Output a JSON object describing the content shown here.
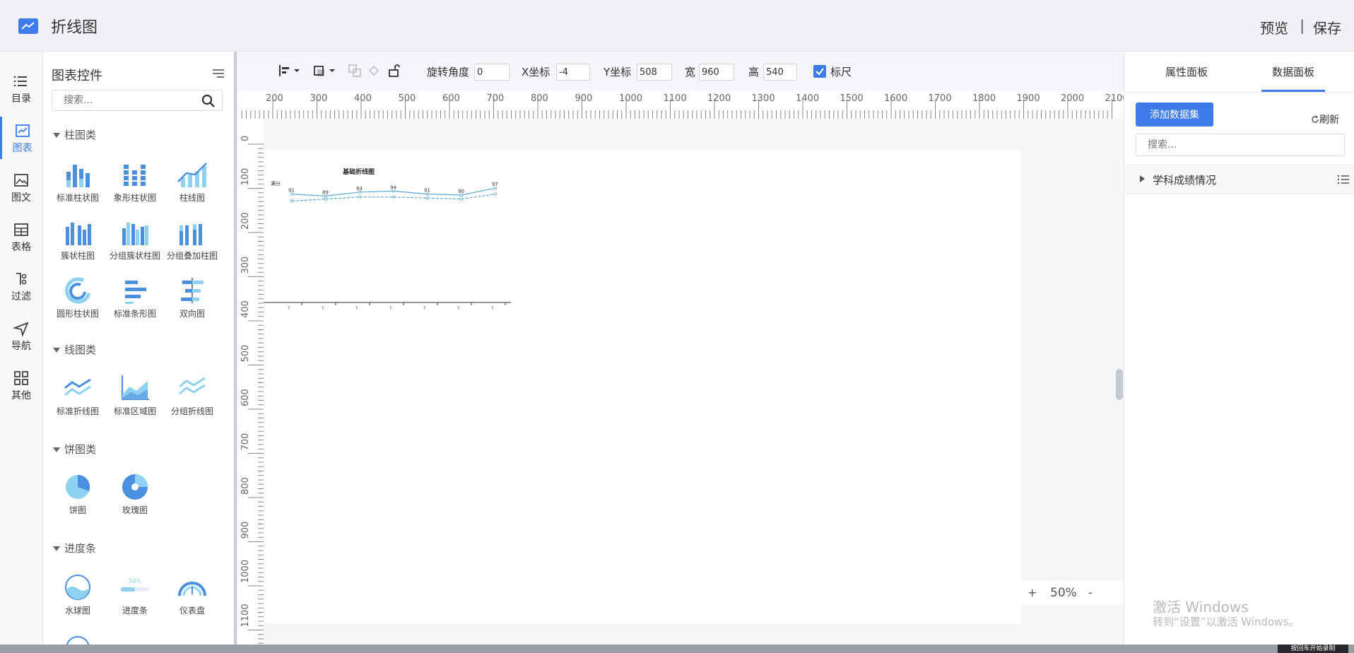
{
  "header": {
    "title": "折线图",
    "preview": "预览",
    "separator": "|",
    "save": "保存"
  },
  "nav": [
    {
      "label": "目录",
      "icon": "list-icon"
    },
    {
      "label": "图表",
      "icon": "chart-icon",
      "active": true
    },
    {
      "label": "图文",
      "icon": "image-icon"
    },
    {
      "label": "表格",
      "icon": "table-icon"
    },
    {
      "label": "过滤",
      "icon": "filter-icon"
    },
    {
      "label": "导航",
      "icon": "send-icon"
    },
    {
      "label": "其他",
      "icon": "grid-icon"
    }
  ],
  "widgets": {
    "title": "图表控件",
    "search_placeholder": "搜索...",
    "categories": {
      "bar": "柱图类",
      "line": "线图类",
      "pie": "饼图类",
      "progress": "进度条"
    },
    "bar_items": [
      "标准柱状图",
      "象形柱状图",
      "柱线图",
      "簇状柱图",
      "分组簇状柱图",
      "分组叠加柱图",
      "圆形柱状图",
      "标准条形图",
      "双向图"
    ],
    "line_items": [
      "标准折线图",
      "标准区域图",
      "分组折线图"
    ],
    "pie_items": [
      "饼图",
      "玫瑰图"
    ],
    "progress_items": [
      "水球图",
      "进度条",
      "仪表盘"
    ],
    "progress_sample_label": "50%"
  },
  "toolbar": {
    "rotate_label": "旋转角度",
    "rotate_value": "0",
    "x_label": "X坐标",
    "x_value": "-4",
    "y_label": "Y坐标",
    "y_value": "508",
    "w_label": "宽",
    "w_value": "960",
    "h_label": "高",
    "h_value": "540",
    "ruler_label": "标尺"
  },
  "rulers": {
    "h_ticks": [
      "200",
      "300",
      "400",
      "500",
      "600",
      "700",
      "800",
      "900",
      "1000",
      "1100",
      "1200",
      "1300",
      "1400",
      "1500",
      "1600",
      "1700",
      "1800",
      "1900",
      "2000",
      "2100"
    ],
    "v_ticks": [
      "0",
      "100",
      "200",
      "300",
      "400",
      "500",
      "600",
      "700",
      "800",
      "900",
      "1000",
      "1100"
    ]
  },
  "zoom": {
    "plus": "+",
    "value": "50%",
    "minus": "-"
  },
  "right_panel": {
    "tab_props": "属性面板",
    "tab_data": "数据面板",
    "add_dataset": "添加数据集",
    "refresh": "刷新",
    "search_placeholder": "搜索...",
    "dataset_name": "学科成绩情况"
  },
  "watermark": {
    "line1": "激活 Windows",
    "line2": "转到“设置”以激活 Windows。"
  },
  "bottom_tag": "按回车开始录制",
  "colors": {
    "accent": "#3d7be8",
    "line": "#5aa8d8"
  },
  "chart_data": {
    "type": "line",
    "title": "基础折线图",
    "ylabel": "满分",
    "categories": [
      "?",
      "?",
      "?",
      "?",
      "?",
      "?",
      "?",
      "?"
    ],
    "series": [
      {
        "values": [
          91,
          89,
          93,
          94,
          91,
          90,
          97
        ]
      },
      {
        "values": [
          84,
          86,
          88,
          88,
          87,
          86,
          91
        ]
      }
    ]
  }
}
